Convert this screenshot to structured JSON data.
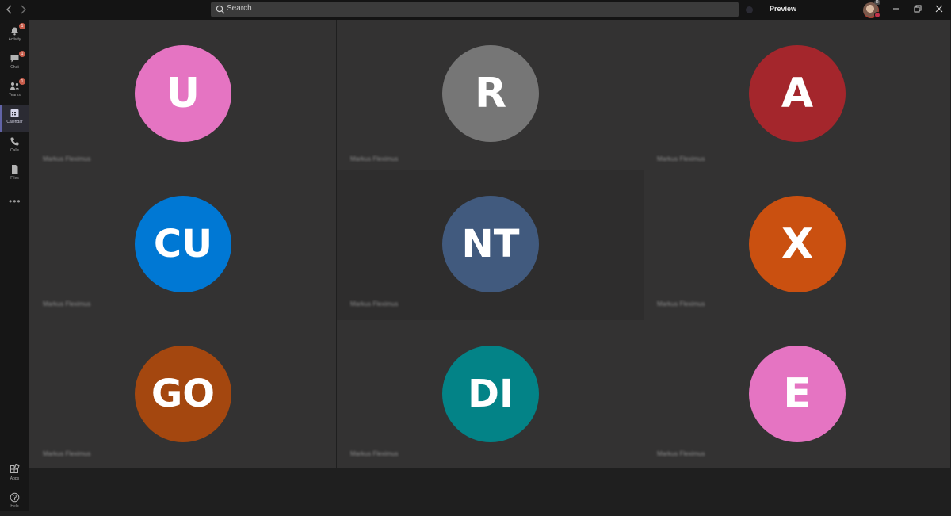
{
  "titlebar": {
    "search_placeholder": "Search",
    "preview_label": "Preview",
    "user_badge": "R"
  },
  "sidebar": {
    "items": [
      {
        "label": "Activity",
        "icon": "bell-icon",
        "badge": "1"
      },
      {
        "label": "Chat",
        "icon": "chat-icon",
        "badge": "1"
      },
      {
        "label": "Teams",
        "icon": "teams-icon",
        "badge": "1"
      },
      {
        "label": "Calendar",
        "icon": "calendar-icon",
        "active": true
      },
      {
        "label": "Calls",
        "icon": "phone-icon"
      },
      {
        "label": "Files",
        "icon": "file-icon"
      }
    ],
    "more": "•••",
    "bottom_items": [
      {
        "label": "Apps",
        "icon": "apps-icon"
      },
      {
        "label": "Help",
        "icon": "help-icon"
      }
    ]
  },
  "participants": [
    {
      "initials": "U",
      "name": "Markus Fleximus",
      "color": "#e574c2"
    },
    {
      "initials": "R",
      "name": "Markus Fleximus",
      "color": "#767676"
    },
    {
      "initials": "A",
      "name": "Markus Fleximus",
      "color": "#a4262c"
    },
    {
      "initials": "CU",
      "name": "Markus Fleximus",
      "color": "#0078d4"
    },
    {
      "initials": "NT",
      "name": "Markus Fleximus",
      "color": "#415a7e"
    },
    {
      "initials": "X",
      "name": "Markus Fleximus",
      "color": "#ca5010"
    },
    {
      "initials": "GO",
      "name": "Markus Fleximus",
      "color": "#a4470f"
    },
    {
      "initials": "DI",
      "name": "Markus Fleximus",
      "color": "#038387"
    },
    {
      "initials": "E",
      "name": "Markus Fleximus",
      "color": "#e574c2"
    }
  ],
  "colors": {
    "tile_bg": "#333232",
    "tile_bg_alt": "#2e2d2d",
    "accent": "#6264a7"
  }
}
